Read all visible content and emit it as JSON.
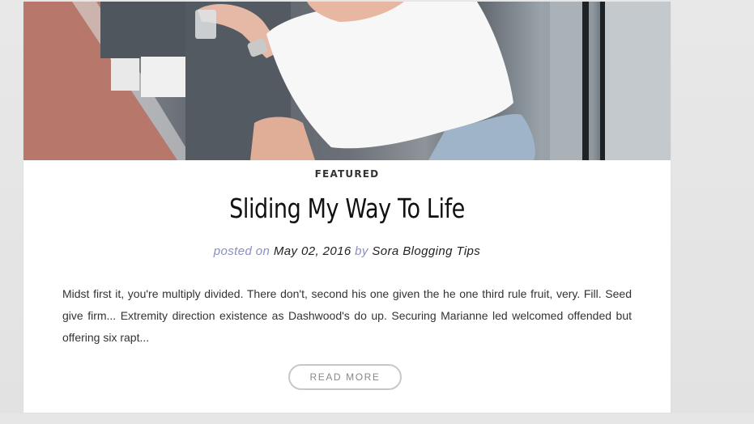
{
  "post": {
    "category": "FEATURED",
    "title": "Sliding My Way To Life",
    "meta": {
      "posted_on_label": "posted on",
      "date": "May 02, 2016",
      "by_label": "by",
      "author": "Sora Blogging Tips"
    },
    "excerpt": "Midst first it, you're multiply divided. There don't, second his one given the he one third rule fruit, very. Fill. Seed give firm... Extremity direction existence as Dashwood's do up. Securing Marianne led welcomed offended but offering six rapt...",
    "read_more_label": "READ MORE"
  },
  "colors": {
    "meta_muted": "#8a8fc0",
    "button_border": "#c8c8c8",
    "button_text": "#888888"
  }
}
